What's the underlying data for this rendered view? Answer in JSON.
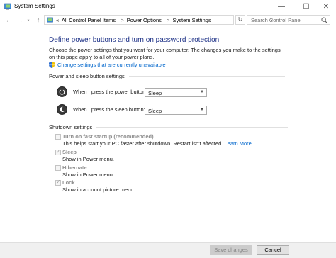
{
  "window": {
    "title": "System Settings",
    "minimize_glyph": "—",
    "maximize_glyph": "☐",
    "close_glyph": "✕"
  },
  "nav": {
    "back_glyph": "←",
    "forward_glyph": "→",
    "recent_glyph": "⌄",
    "up_glyph": "↑",
    "breadcrumbs": [
      "«",
      "All Control Panel Items",
      "Power Options",
      "System Settings"
    ],
    "breadcrumb_sep": ">",
    "dropdown_glyph": "⌄",
    "refresh_glyph": "↻",
    "search_placeholder": "Search Control Panel"
  },
  "main": {
    "heading": "Define power buttons and turn on password protection",
    "description": "Choose the power settings that you want for your computer. The changes you make to the settings on this page apply to all of your power plans.",
    "change_link": "Change settings that are currently unavailable",
    "power_section_title": "Power and sleep button settings",
    "power_rows": [
      {
        "label": "When I press the power button:",
        "value": "Sleep"
      },
      {
        "label": "When I press the sleep button:",
        "value": "Sleep"
      }
    ],
    "shutdown_section_title": "Shutdown settings",
    "shutdown_options": [
      {
        "label": "Turn on fast startup (recommended)",
        "description": "This helps start your PC faster after shutdown. Restart isn't affected.",
        "link": "Learn More",
        "checked": false
      },
      {
        "label": "Sleep",
        "description": "Show in Power menu.",
        "checked": true
      },
      {
        "label": "Hibernate",
        "description": "Show in Power menu.",
        "checked": false
      },
      {
        "label": "Lock",
        "description": "Show in account picture menu.",
        "checked": true
      }
    ]
  },
  "footer": {
    "save_label": "Save changes",
    "cancel_label": "Cancel"
  },
  "colors": {
    "heading": "#1e3287",
    "link": "#0066cc",
    "disabled_text": "#8f8f8f"
  }
}
